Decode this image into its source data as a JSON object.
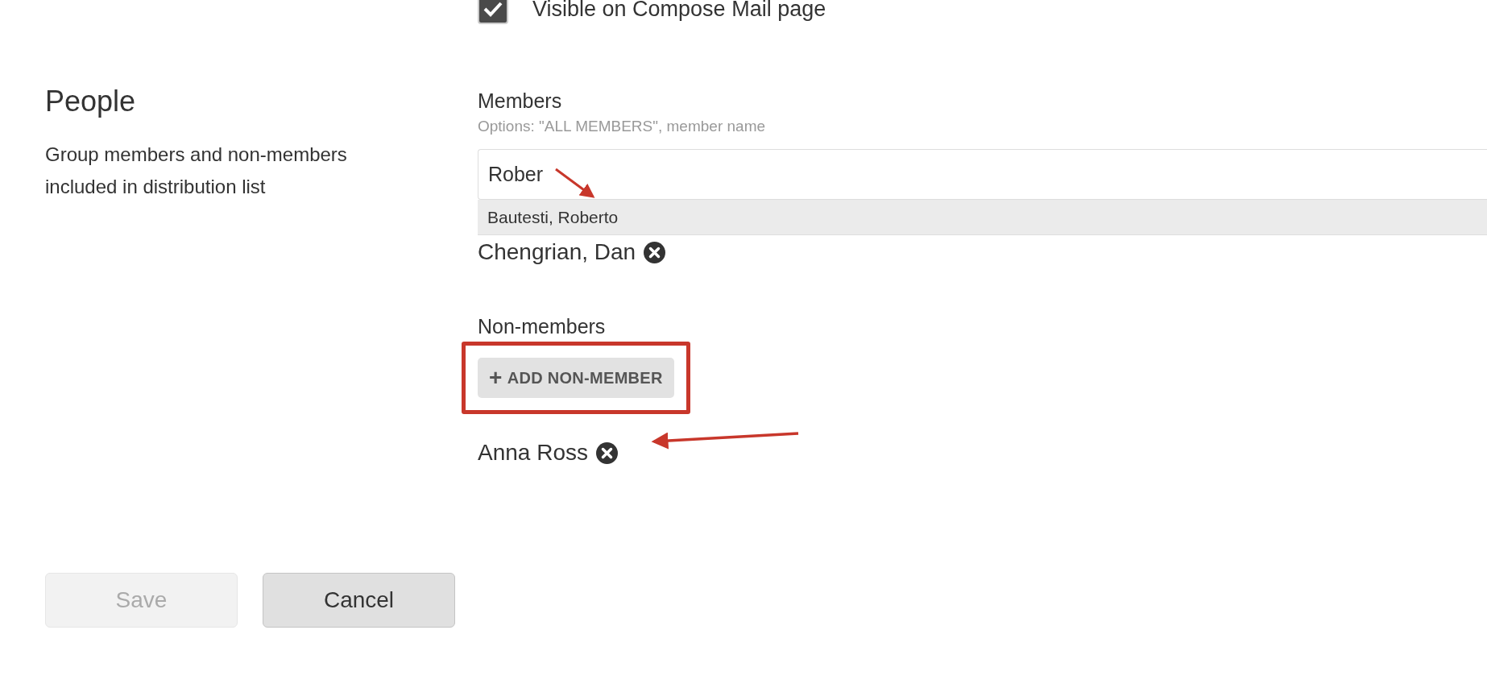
{
  "visibility": {
    "label": "Visible on Compose Mail page",
    "checked": true
  },
  "section": {
    "title": "People",
    "description": "Group members and non-members included in distribution list"
  },
  "members": {
    "label": "Members",
    "hint": "Options: \"ALL MEMBERS\", member name",
    "value": "Rober",
    "suggestions": [
      {
        "label": "Bautesti, Roberto",
        "highlighted": true
      }
    ],
    "items": [
      {
        "name": "Chengrian, Dan"
      }
    ]
  },
  "non_members": {
    "label": "Non-members",
    "add_button": {
      "icon": "+",
      "label": "ADD NON-MEMBER",
      "highlighted": true
    },
    "items": [
      {
        "name": "Anna Ross"
      }
    ]
  },
  "buttons": [
    {
      "label": "Save",
      "disabled": true
    },
    {
      "label": "Cancel",
      "disabled": false
    }
  ]
}
